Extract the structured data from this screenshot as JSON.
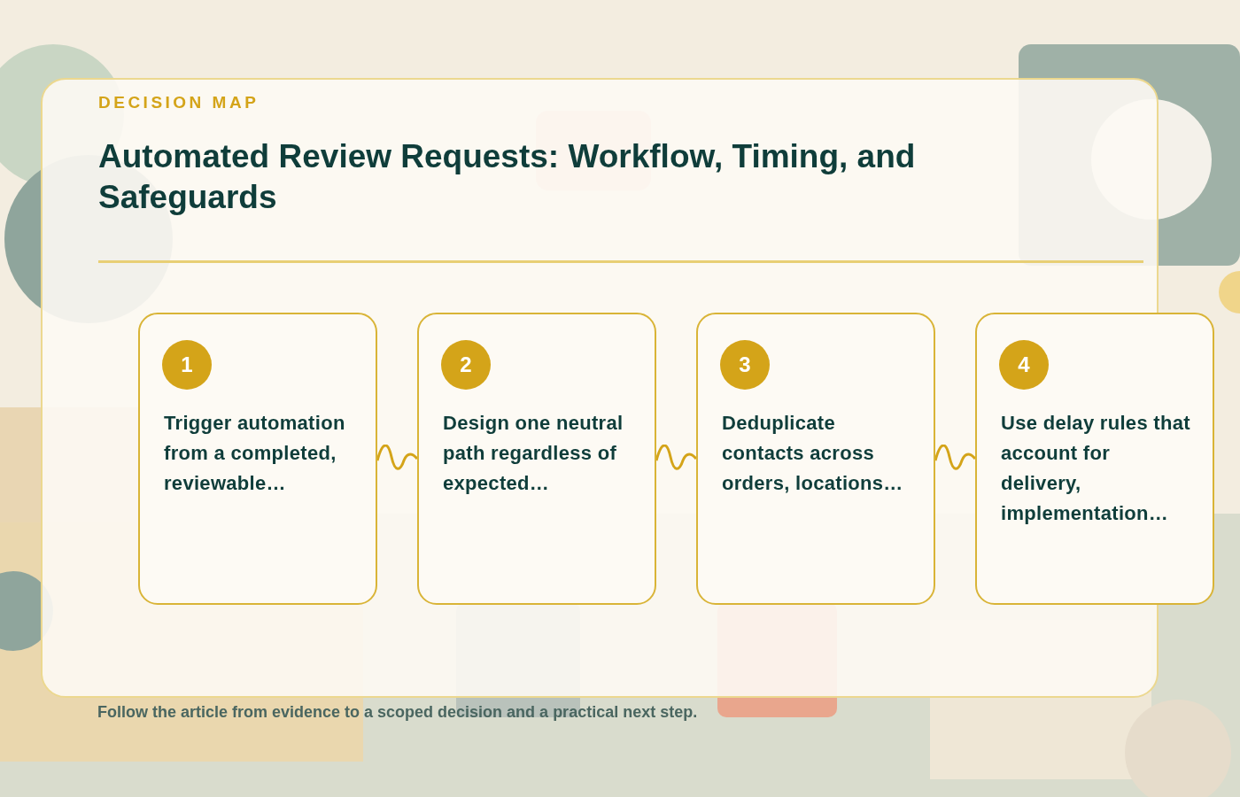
{
  "eyebrow": "DECISION MAP",
  "title": "Automated Review Requests: Workflow, Timing, and Safeguards",
  "steps": [
    {
      "number": "1",
      "text": "Trigger automation from a completed, reviewable…"
    },
    {
      "number": "2",
      "text": "Design one neutral path regardless of expected…"
    },
    {
      "number": "3",
      "text": "Deduplicate contacts across orders, locations…"
    },
    {
      "number": "4",
      "text": "Use delay rules that account for delivery, implementation…"
    }
  ],
  "footer": "Follow the article from evidence to a scoped decision and a practical next step."
}
